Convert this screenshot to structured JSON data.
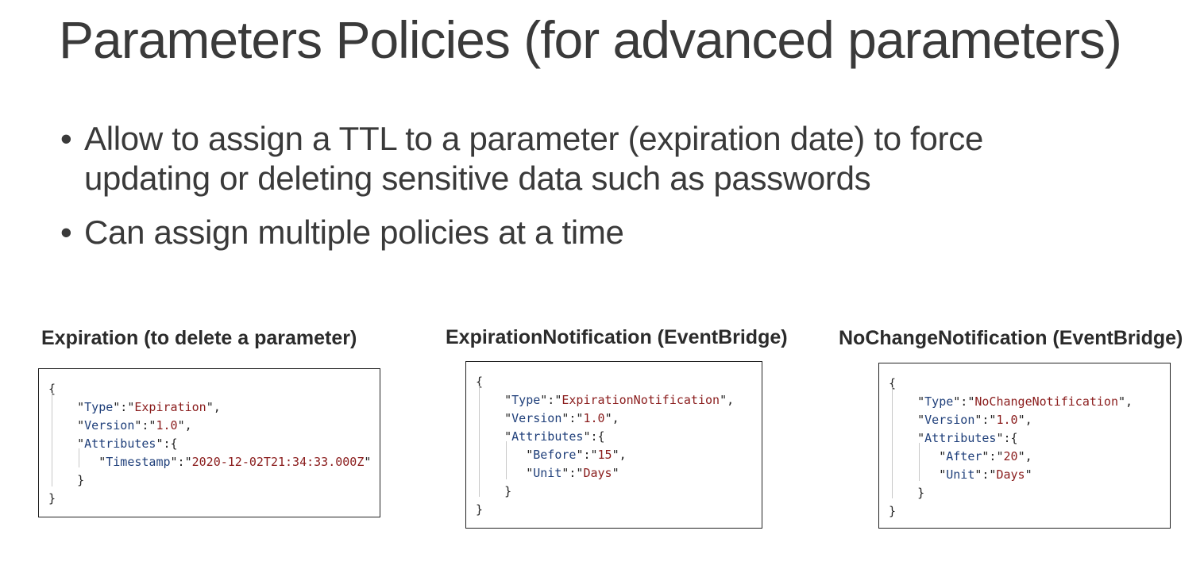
{
  "title": "Parameters Policies (for advanced parameters)",
  "bullets": [
    {
      "line1": "Allow to assign a TTL to a parameter (expiration date) to force",
      "line2": "updating or deleting sensitive data such as passwords"
    },
    {
      "line1": "Can assign multiple policies at a time"
    }
  ],
  "policies": [
    {
      "heading": "Expiration (to delete a parameter)",
      "type": "Expiration",
      "version": "1.0",
      "attributes": [
        {
          "key": "Timestamp",
          "value": "2020-12-02T21:34:33.000Z"
        }
      ]
    },
    {
      "heading": "ExpirationNotification (EventBridge)",
      "type": "ExpirationNotification",
      "version": "1.0",
      "attributes": [
        {
          "key": "Before",
          "value": "15"
        },
        {
          "key": "Unit",
          "value": "Days"
        }
      ]
    },
    {
      "heading": "NoChangeNotification (EventBridge)",
      "type": "NoChangeNotification",
      "version": "1.0",
      "attributes": [
        {
          "key": "After",
          "value": "20"
        },
        {
          "key": "Unit",
          "value": "Days"
        }
      ]
    }
  ],
  "json_keys": {
    "type": "Type",
    "version": "Version",
    "attributes": "Attributes"
  },
  "colors": {
    "key": "#1f3f7a",
    "value": "#8a1c1c",
    "text": "#3a3a3a"
  }
}
